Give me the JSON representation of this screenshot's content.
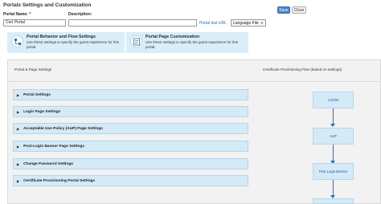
{
  "header": {
    "title": "Portals Settings and Customization",
    "save_label": "Save",
    "close_label": "Close"
  },
  "form": {
    "portal_name_label": "Portal Name:",
    "required_mark": "*",
    "portal_name_value": "Cert Portal",
    "description_label": "Description:",
    "description_value": "",
    "portal_test_url_label": "Portal test URL",
    "language_file_label": "Language File"
  },
  "info_boxes": [
    {
      "title": "Portal Behavior and Flow Settings",
      "description": "Use these settings to specify the guest experience for this portal.",
      "icon": "workflow-icon"
    },
    {
      "title": "Portal Page Customization",
      "description": "Use these settings to specify the guest experience for this portal.",
      "icon": "page-customization-icon"
    }
  ],
  "main": {
    "left_heading": "Portal & Page Settings",
    "right_heading": "Certificate Provisioning Flow (based on settings)",
    "sections": [
      "Portal Settings",
      "Login Page Settings",
      "Acceptable Use Policy (AUP) Page Settings",
      "Post-Login Banner Page Settings",
      "Change Password Settings",
      "Certificate Provisioning Portal Settings"
    ],
    "flow_steps": [
      "LOGIN",
      "AUP",
      "Post Login Banner",
      ""
    ]
  },
  "colors": {
    "accent": "#4a84c8",
    "panel_blue": "#d4eaf6",
    "link": "#2a6ebb"
  }
}
